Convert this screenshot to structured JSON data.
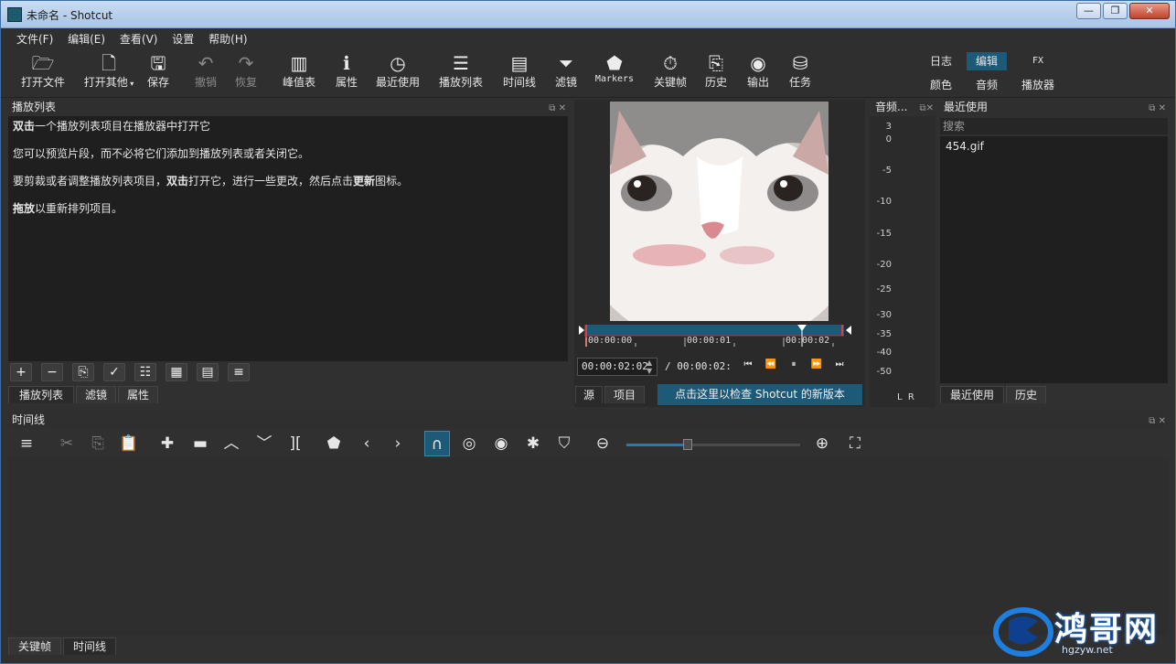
{
  "window": {
    "title": "未命名 - Shotcut",
    "controls": [
      "—",
      "❐",
      "✕"
    ]
  },
  "menu": [
    "文件(F)",
    "编辑(E)",
    "查看(V)",
    "设置",
    "帮助(H)"
  ],
  "toolbar": {
    "items": [
      {
        "label": "打开文件",
        "icon": "folder-open-icon",
        "enabled": true
      },
      {
        "label": "打开其他",
        "icon": "open-other-icon",
        "enabled": true
      },
      {
        "label": "保存",
        "icon": "save-icon",
        "enabled": true
      },
      {
        "label": "撤销",
        "icon": "undo-icon",
        "enabled": false
      },
      {
        "label": "恢复",
        "icon": "redo-icon",
        "enabled": false
      },
      {
        "label": "峰值表",
        "icon": "peak-meter-icon",
        "enabled": true
      },
      {
        "label": "属性",
        "icon": "info-icon",
        "enabled": true
      },
      {
        "label": "最近使用",
        "icon": "clock-icon",
        "enabled": true
      },
      {
        "label": "播放列表",
        "icon": "list-icon",
        "enabled": true
      },
      {
        "label": "时间线",
        "icon": "timeline-icon",
        "enabled": true
      },
      {
        "label": "滤镜",
        "icon": "filter-icon",
        "enabled": true
      },
      {
        "label": "Markers",
        "icon": "marker-icon",
        "enabled": true
      },
      {
        "label": "关键帧",
        "icon": "stopwatch-icon",
        "enabled": true
      },
      {
        "label": "历史",
        "icon": "history-icon",
        "enabled": true
      },
      {
        "label": "输出",
        "icon": "disc-icon",
        "enabled": true
      },
      {
        "label": "任务",
        "icon": "database-icon",
        "enabled": true
      }
    ],
    "layouts_top": [
      "日志",
      "编辑",
      "FX"
    ],
    "layouts_bottom": [
      "颜色",
      "音频",
      "播放器"
    ],
    "active_layout": "编辑"
  },
  "playlist": {
    "title": "播放列表",
    "help": {
      "l1_b": "双击",
      "l1": "一个播放列表项目在播放器中打开它",
      "l2": "您可以预览片段，而不必将它们添加到播放列表或者关闭它。",
      "l3_a": "要剪裁或者调整播放列表项目，",
      "l3_b": "双击",
      "l3_c": "打开它，进行一些更改，然后点击",
      "l3_d": "更新",
      "l3_e": "图标。",
      "l4_b": "拖放",
      "l4": "以重新排列项目。"
    },
    "tabs": [
      "播放列表",
      "滤镜",
      "属性"
    ]
  },
  "player": {
    "ruler": [
      "00:00:00",
      "00:00:01",
      "00:00:02"
    ],
    "timecode": "00:00:02:02",
    "total": "/ 00:00:02:",
    "tabs": [
      "源",
      "项目"
    ],
    "update_text": "点击这里以检查 Shotcut 的新版本"
  },
  "audio": {
    "title": "音频...",
    "scale": [
      "3",
      "0",
      "-5",
      "-10",
      "-15",
      "-20",
      "-25",
      "-30",
      "-35",
      "-40",
      "-50"
    ],
    "channels": "L  R"
  },
  "recent": {
    "title": "最近使用",
    "search_placeholder": "搜索",
    "items": [
      "454.gif"
    ],
    "tabs": [
      "最近使用",
      "历史"
    ]
  },
  "timeline": {
    "title": "时间线",
    "zoom_level": 0.35
  },
  "bottom_tabs": [
    "关键帧",
    "时间线"
  ],
  "watermark": {
    "text": "鸿哥网",
    "url": "hgzyw.net"
  },
  "colors": {
    "accent": "#1c5a78",
    "panel": "#1f1f1f",
    "bg": "#303030"
  }
}
